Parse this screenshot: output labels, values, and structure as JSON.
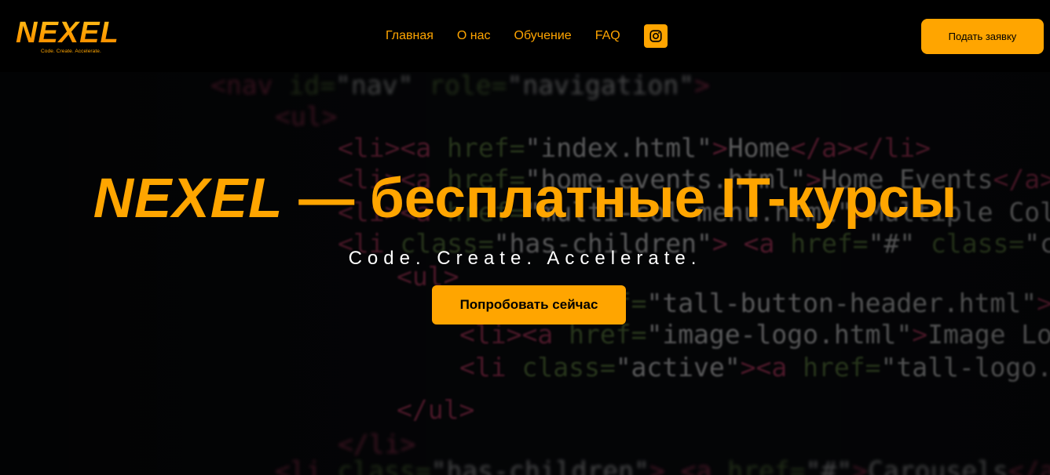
{
  "header": {
    "logo_text": "NEXEL",
    "logo_tagline": "Code. Create. Accelerate.",
    "nav": [
      {
        "label": "Главная"
      },
      {
        "label": "О нас"
      },
      {
        "label": "Обучение"
      },
      {
        "label": "FAQ"
      }
    ],
    "instagram_icon": "instagram-icon",
    "cta_label": "Подать заявку"
  },
  "hero": {
    "title_brand": "NEXEL",
    "title_rest": " — бесплатные IT-курсы",
    "subtitle": "Code. Create. Accelerate.",
    "button_label": "Попробовать сейчас"
  },
  "background_code": [
    "<nav id=\"nav\" role=\"navigation\">",
    "<ul>",
    "<li><a href=\"index.html\">Home</a></li>",
    "<li><a href=\"home-events.html\">Home Events</a></li>",
    "<li><a href=\"multi-col-menu.html\">Multiple Column Menu</a></li>",
    "<li class=\"has-children\"> <a href=\"#\" class=\"current\">",
    "<ul>",
    "<li><a href=\"tall-button-header.html\">Tall Button",
    "<li><a href=\"image-logo.html\">Image Logo</a></li>",
    "<li class=\"active\"><a href=\"tall-logo.html\">Tall Logo</a></li>",
    "</ul>",
    "</li>",
    "<li class=\"has-children\"> <a href=\"#\">Carousels</a>"
  ],
  "colors": {
    "accent": "#ffa500",
    "background": "#000000",
    "subtitle": "#ffffff",
    "code_tag": "#b0345a",
    "code_attr": "#5a7a3a",
    "code_string": "#c8c8c8"
  }
}
